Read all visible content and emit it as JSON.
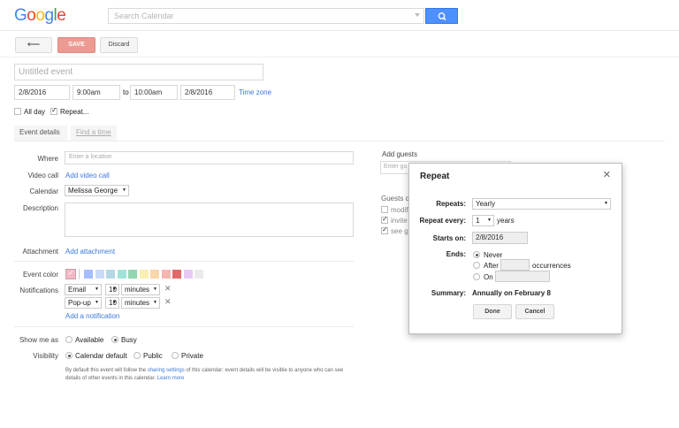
{
  "header": {
    "logo": "Google",
    "search_placeholder": "Search Calendar"
  },
  "toolbar": {
    "back_label": "⟵",
    "save_label": "SAVE",
    "discard_label": "Discard"
  },
  "event": {
    "title_placeholder": "Untitled event",
    "start_date": "2/8/2016",
    "start_time": "9:00am",
    "to_label": "to",
    "end_time": "10:00am",
    "end_date": "2/8/2016",
    "timezone_link": "Time zone",
    "all_day_label": "All day",
    "all_day_checked": false,
    "repeat_label": "Repeat...",
    "repeat_checked": true
  },
  "tabs": {
    "event_details": "Event details",
    "find_a_time": "Find a time"
  },
  "details": {
    "where_label": "Where",
    "where_placeholder": "Enter a location",
    "video_call_label": "Video call",
    "video_call_link": "Add video call",
    "calendar_label": "Calendar",
    "calendar_value": "Melissa George",
    "description_label": "Description",
    "attachment_label": "Attachment",
    "attachment_link": "Add attachment",
    "event_color_label": "Event color",
    "event_colors": [
      "#a4bdfc",
      "#c9daf8",
      "#b6d7e4",
      "#a2e3d9",
      "#93d4b1",
      "#fbf0b0",
      "#f9d7ab",
      "#f8b4b2",
      "#e06a6a",
      "#e8c9f4",
      "#eaeaea"
    ],
    "notifications_label": "Notifications",
    "notifications": [
      {
        "method": "Email",
        "amount": "10",
        "unit": "minutes"
      },
      {
        "method": "Pop-up",
        "amount": "10",
        "unit": "minutes"
      }
    ],
    "add_notification_link": "Add a notification",
    "show_me_as_label": "Show me as",
    "show_available": "Available",
    "show_busy": "Busy",
    "visibility_label": "Visibility",
    "visibility_default": "Calendar default",
    "visibility_public": "Public",
    "visibility_private": "Private",
    "footnote_1": "By default this event will follow the",
    "footnote_link": "sharing settings",
    "footnote_2": "of this calendar: event details will be visible to anyone who",
    "footnote_3": "can see details of other events in this calendar.",
    "learn_more_link": "Learn more"
  },
  "guests": {
    "add_guests_label": "Add guests",
    "guest_input_placeholder": "Enter gu",
    "guests_can_label": "Guests c",
    "options": [
      "modif",
      "invite",
      "see g"
    ]
  },
  "repeat_dialog": {
    "title": "Repeat",
    "close_icon_glyph": "✕",
    "repeats_label": "Repeats:",
    "repeats_value": "Yearly",
    "repeat_every_label": "Repeat every:",
    "repeat_every_value": "1",
    "repeat_every_unit": "years",
    "starts_on_label": "Starts on:",
    "starts_on_value": "2/8/2016",
    "ends_label": "Ends:",
    "ends_never": "Never",
    "ends_after": "After",
    "ends_after_unit": "occurrences",
    "ends_on": "On",
    "summary_label": "Summary:",
    "summary_value": "Annually on February 8",
    "done_label": "Done",
    "cancel_label": "Cancel"
  }
}
